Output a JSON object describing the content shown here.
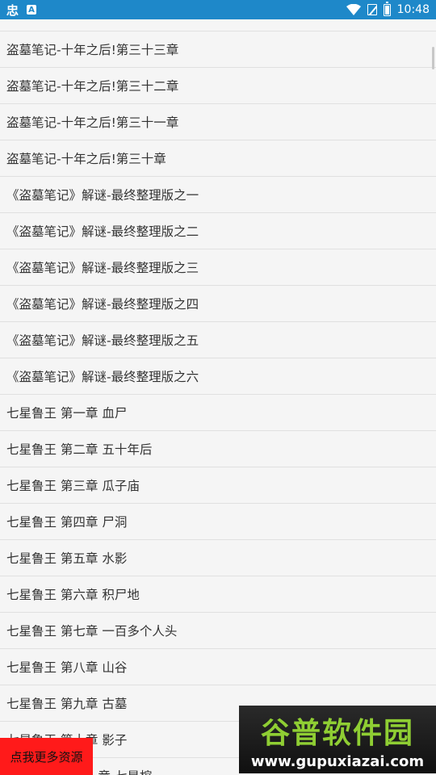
{
  "status_bar": {
    "app_icon": "忠",
    "notif_icon": "A",
    "time": "10:48",
    "icons": [
      "wifi-icon",
      "no-sim-icon",
      "battery-icon"
    ]
  },
  "chapters": [
    "盗墓笔记-十年之后!第三十三章",
    "盗墓笔记-十年之后!第三十二章",
    "盗墓笔记-十年之后!第三十一章",
    "盗墓笔记-十年之后!第三十章",
    "《盗墓笔记》解谜-最终整理版之一",
    "《盗墓笔记》解谜-最终整理版之二",
    "《盗墓笔记》解谜-最终整理版之三",
    "《盗墓笔记》解谜-最终整理版之四",
    "《盗墓笔记》解谜-最终整理版之五",
    "《盗墓笔记》解谜-最终整理版之六",
    "七星鲁王 第一章 血尸",
    "七星鲁王 第二章 五十年后",
    "七星鲁王 第三章 瓜子庙",
    "七星鲁王 第四章 尸洞",
    "七星鲁王 第五章 水影",
    "七星鲁王 第六章 积尸地",
    "七星鲁王 第七章 一百多个人头",
    "七星鲁王 第八章 山谷",
    "七星鲁王 第九章 古墓",
    "七星鲁王 第十章 影子",
    "七星鲁王 第十一章 七星棺"
  ],
  "more_button": {
    "label": "点我更多资源"
  },
  "watermark": {
    "title": "谷普软件园",
    "url": "www.gupuxiazai.com"
  }
}
